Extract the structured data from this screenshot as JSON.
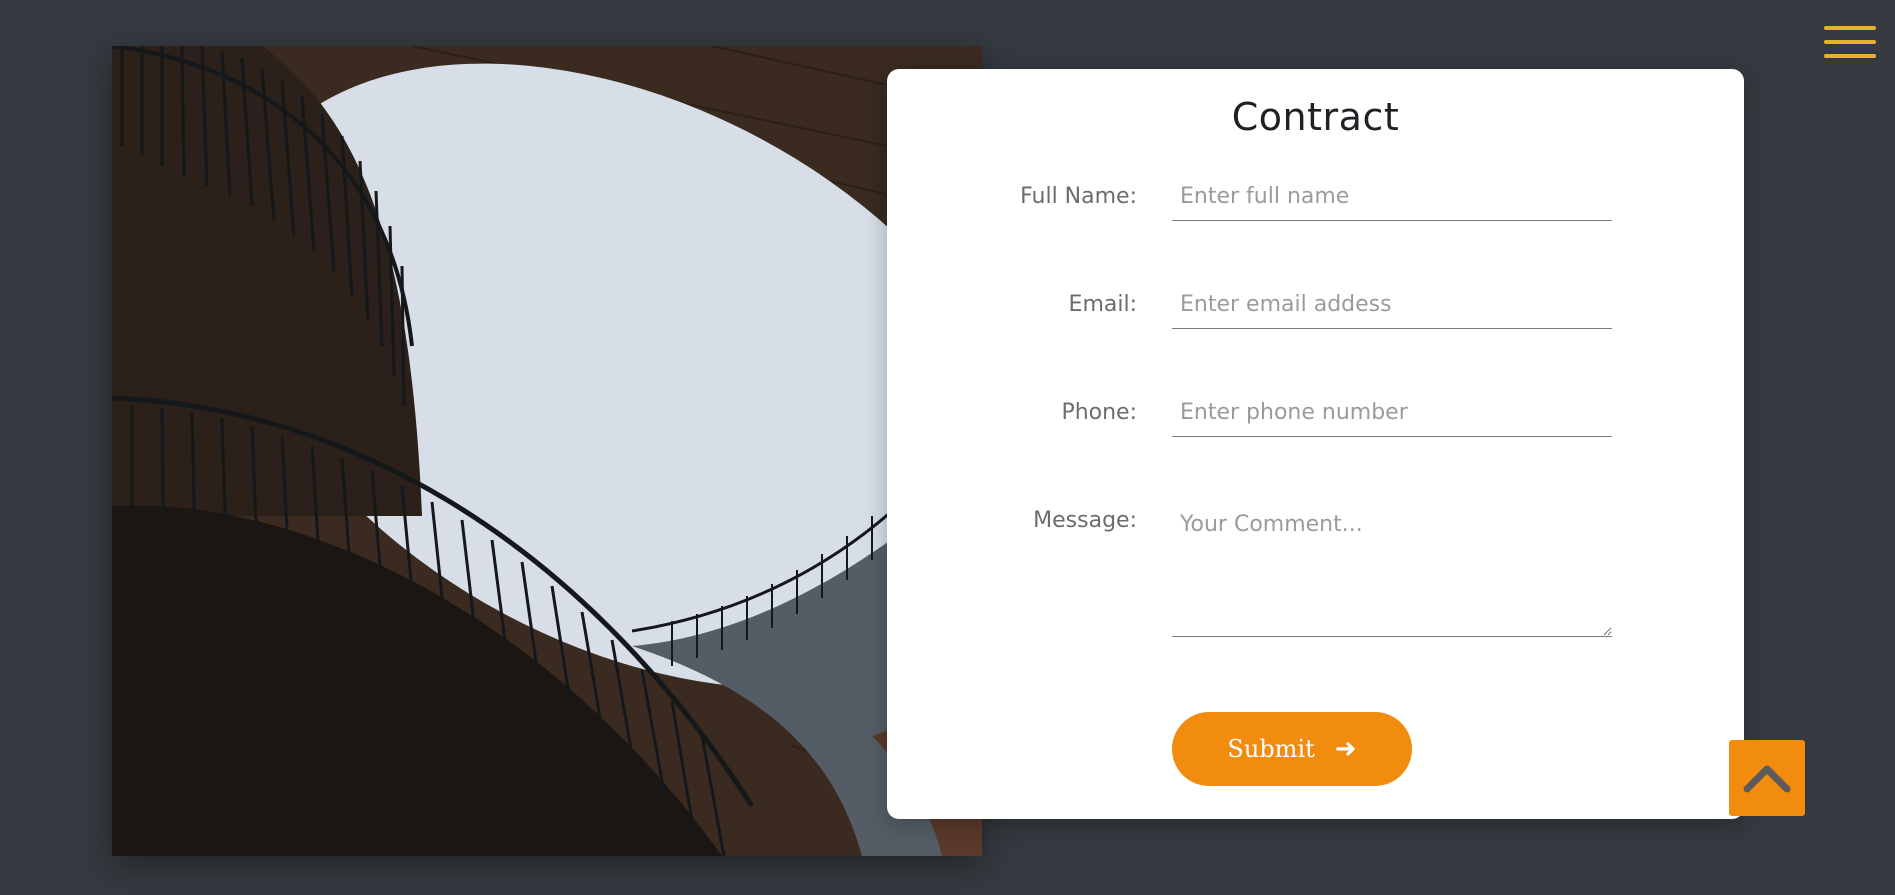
{
  "form": {
    "title": "Contract",
    "fields": [
      {
        "label": "Full Name:",
        "placeholder": "Enter full name",
        "value": ""
      },
      {
        "label": "Email:",
        "placeholder": "Enter email addess",
        "value": ""
      },
      {
        "label": "Phone:",
        "placeholder": "Enter phone number",
        "value": ""
      },
      {
        "label": "Message:",
        "placeholder": "Your Comment...",
        "value": ""
      }
    ],
    "submit_label": "Submit",
    "submit_icon": "arrow-right-icon"
  },
  "nav": {
    "menu_icon": "hamburger-menu-icon"
  },
  "scroll_top": {
    "icon": "chevron-up-icon"
  },
  "colors": {
    "background": "#353a40",
    "accent": "#f28c0f",
    "menu": "#e3b32d",
    "card": "#ffffff",
    "title": "#1e2226"
  }
}
